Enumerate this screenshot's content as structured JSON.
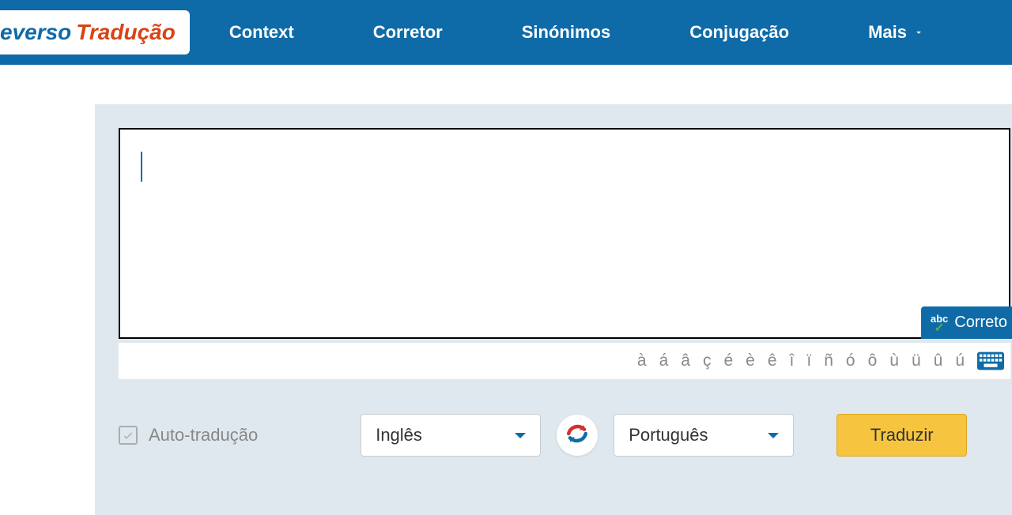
{
  "logo": {
    "first": "everso",
    "second": "Tradução"
  },
  "nav": {
    "context": "Context",
    "corrector": "Corretor",
    "synonyms": "Sinónimos",
    "conjugation": "Conjugação",
    "more": "Mais"
  },
  "input": {
    "value": ""
  },
  "correctorBadge": {
    "label": "Correto",
    "abc": "abc"
  },
  "accents": [
    "à",
    "á",
    "â",
    "ç",
    "é",
    "è",
    "ê",
    "î",
    "ï",
    "ñ",
    "ó",
    "ô",
    "ù",
    "ü",
    "û",
    "ú"
  ],
  "controls": {
    "autoTranslate": "Auto-tradução",
    "sourceLang": "Inglês",
    "targetLang": "Português",
    "translateBtn": "Traduzir"
  }
}
